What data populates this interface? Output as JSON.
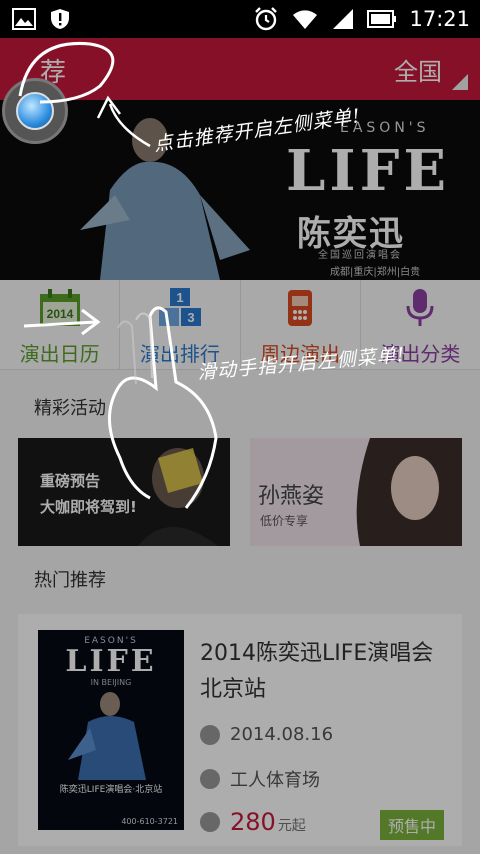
{
  "status_bar": {
    "time": "17:21"
  },
  "header": {
    "title_partial": "荐",
    "city": "全国"
  },
  "banner": {
    "small_title": "EASON'S",
    "headline": "LIFE",
    "artist": "陈奕迅",
    "tour": "全国巡回演唱会",
    "cities": "成都|重庆|郑州|白贵"
  },
  "nav": [
    {
      "label": "演出日历",
      "icon": "calendar-2014-icon",
      "color": "#5aa02c"
    },
    {
      "label": "演出排行",
      "icon": "ranking-icon",
      "color": "#2a7bd0"
    },
    {
      "label": "周边演出",
      "icon": "nearby-phone-icon",
      "color": "#d94a1e"
    },
    {
      "label": "演出分类",
      "icon": "microphone-icon",
      "color": "#8e3fa3"
    }
  ],
  "sections": {
    "activities": "精彩活动",
    "hot": "热门推荐"
  },
  "activities": [
    {
      "line1": "重磅预告",
      "line2": "大咖即将驾到!"
    },
    {
      "name": "孙燕姿",
      "sub": "低价专享"
    }
  ],
  "featured": {
    "poster_top": "EASON'S",
    "poster_title": "LIFE",
    "poster_sub": "IN BEIJING",
    "poster_caption": "陈奕迅LIFE演唱会·北京站",
    "poster_phone": "400-610-3721",
    "title": "2014陈奕迅LIFE演唱会 北京站",
    "date": "2014.08.16",
    "venue": "工人体育场",
    "price": "280",
    "price_unit": "元起",
    "status": "预售中"
  },
  "tutorial": {
    "hint_tap": "点击推荐开启左侧菜单!",
    "hint_swipe": "滑动手指开启左侧菜单!"
  }
}
